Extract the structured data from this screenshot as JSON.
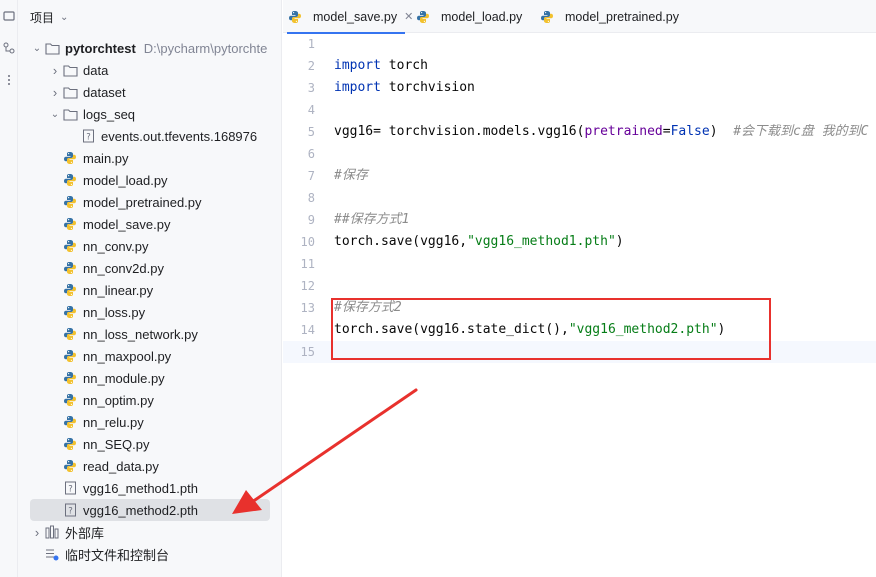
{
  "project_panel": {
    "title": "项目",
    "tree": [
      {
        "name": "pytorchtest",
        "path": "D:\\pycharm\\pytorchte",
        "kind": "folder",
        "expanded": true
      },
      {
        "name": "data",
        "kind": "folder",
        "expanded": false
      },
      {
        "name": "dataset",
        "kind": "folder",
        "expanded": false
      },
      {
        "name": "logs_seq",
        "kind": "folder",
        "expanded": true
      },
      {
        "name": "events.out.tfevents.168976",
        "kind": "unknown-file"
      },
      {
        "name": "main.py",
        "kind": "python-file"
      },
      {
        "name": "model_load.py",
        "kind": "python-file"
      },
      {
        "name": "model_pretrained.py",
        "kind": "python-file"
      },
      {
        "name": "model_save.py",
        "kind": "python-file"
      },
      {
        "name": "nn_conv.py",
        "kind": "python-file"
      },
      {
        "name": "nn_conv2d.py",
        "kind": "python-file"
      },
      {
        "name": "nn_linear.py",
        "kind": "python-file"
      },
      {
        "name": "nn_loss.py",
        "kind": "python-file"
      },
      {
        "name": "nn_loss_network.py",
        "kind": "python-file"
      },
      {
        "name": "nn_maxpool.py",
        "kind": "python-file"
      },
      {
        "name": "nn_module.py",
        "kind": "python-file"
      },
      {
        "name": "nn_optim.py",
        "kind": "python-file"
      },
      {
        "name": "nn_relu.py",
        "kind": "python-file"
      },
      {
        "name": "nn_SEQ.py",
        "kind": "python-file"
      },
      {
        "name": "read_data.py",
        "kind": "python-file"
      },
      {
        "name": "vgg16_method1.pth",
        "kind": "unknown-file"
      },
      {
        "name": "vgg16_method2.pth",
        "kind": "unknown-file",
        "selected": true
      },
      {
        "name": "外部库",
        "kind": "library"
      },
      {
        "name": "临时文件和控制台",
        "kind": "scratches"
      }
    ]
  },
  "tabs": [
    {
      "label": "model_save.py",
      "active": true
    },
    {
      "label": "model_load.py",
      "active": false
    },
    {
      "label": "model_pretrained.py",
      "active": false
    }
  ],
  "editor": {
    "current_line": 15,
    "lines": [
      {
        "n": "1",
        "tokens": []
      },
      {
        "n": "2",
        "tokens": [
          {
            "t": "import",
            "c": "kw"
          },
          {
            "t": " torch",
            "c": ""
          }
        ]
      },
      {
        "n": "3",
        "tokens": [
          {
            "t": "import",
            "c": "kw"
          },
          {
            "t": " torchvision",
            "c": ""
          }
        ]
      },
      {
        "n": "4",
        "tokens": []
      },
      {
        "n": "5",
        "tokens": [
          {
            "t": "vgg16= torchvision.models.vgg16(",
            "c": ""
          },
          {
            "t": "pretrained",
            "c": "param"
          },
          {
            "t": "=",
            "c": ""
          },
          {
            "t": "False",
            "c": "kw"
          },
          {
            "t": ")  ",
            "c": ""
          },
          {
            "t": "#会下载到c盘 我的到C",
            "c": "cmt"
          }
        ]
      },
      {
        "n": "6",
        "tokens": []
      },
      {
        "n": "7",
        "tokens": [
          {
            "t": "#保存",
            "c": "cmt"
          }
        ]
      },
      {
        "n": "8",
        "tokens": []
      },
      {
        "n": "9",
        "tokens": [
          {
            "t": "##保存方式1",
            "c": "cmt"
          }
        ]
      },
      {
        "n": "10",
        "tokens": [
          {
            "t": "torch.save(vgg16,",
            "c": ""
          },
          {
            "t": "\"vgg16_method1.pth\"",
            "c": "str"
          },
          {
            "t": ")",
            "c": ""
          }
        ]
      },
      {
        "n": "11",
        "tokens": []
      },
      {
        "n": "12",
        "tokens": []
      },
      {
        "n": "13",
        "tokens": [
          {
            "t": "#保存方式2",
            "c": "cmt"
          }
        ]
      },
      {
        "n": "14",
        "tokens": [
          {
            "t": "torch.save(vgg16.state_dict(),",
            "c": ""
          },
          {
            "t": "\"vgg16_method2.pth\"",
            "c": "str"
          },
          {
            "t": ")",
            "c": ""
          }
        ]
      },
      {
        "n": "15",
        "tokens": []
      }
    ]
  },
  "colors": {
    "annotation_red": "#e8312d",
    "accent_blue": "#3574f0",
    "keyword": "#0033b3",
    "string": "#067d17",
    "comment": "#8c8c8c"
  }
}
